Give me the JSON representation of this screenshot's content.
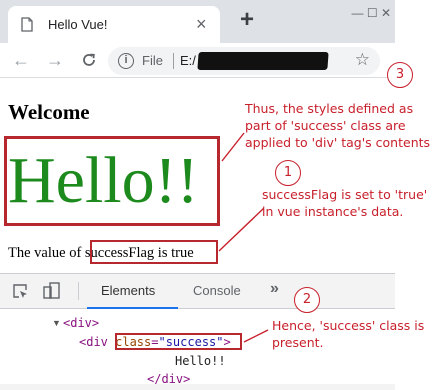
{
  "browser": {
    "tab_title": "Hello Vue!",
    "tab_close": "×",
    "new_tab": "+",
    "back": "←",
    "forward": "→",
    "reload": "C",
    "info_icon": "i",
    "scheme_label": "File",
    "url_visible": "E:/",
    "bookmark_star": "☆",
    "window_controls": "— ☐ ✕"
  },
  "page": {
    "heading": "Welcome",
    "hello": "Hello!!",
    "value_prefix": "The value of ",
    "value_highlight": "successFlag is true"
  },
  "devtools": {
    "tabs": [
      "Elements",
      "Console"
    ],
    "more": "»",
    "code": {
      "line1": "<div>",
      "line2_open": "<div ",
      "line2_attr": "class",
      "line2_eq": "=",
      "line2_val": "\"success\"",
      "line2_close": ">",
      "line3": "Hello!!",
      "line4": "</div>"
    }
  },
  "annotations": [
    {
      "number": "1",
      "text": "successFlag is set to 'true' in vue instance's data."
    },
    {
      "number": "2",
      "text": "Hence, 'success' class is present."
    },
    {
      "number": "3",
      "text": "Thus, the styles defined as part of 'success' class are applied to 'div' tag's contents"
    }
  ],
  "colors": {
    "annotation": "#c8202b",
    "highlight_box": "#b7282e",
    "hello_green": "#1d8a1d",
    "devtools_tab_underline": "#1a73e8"
  }
}
